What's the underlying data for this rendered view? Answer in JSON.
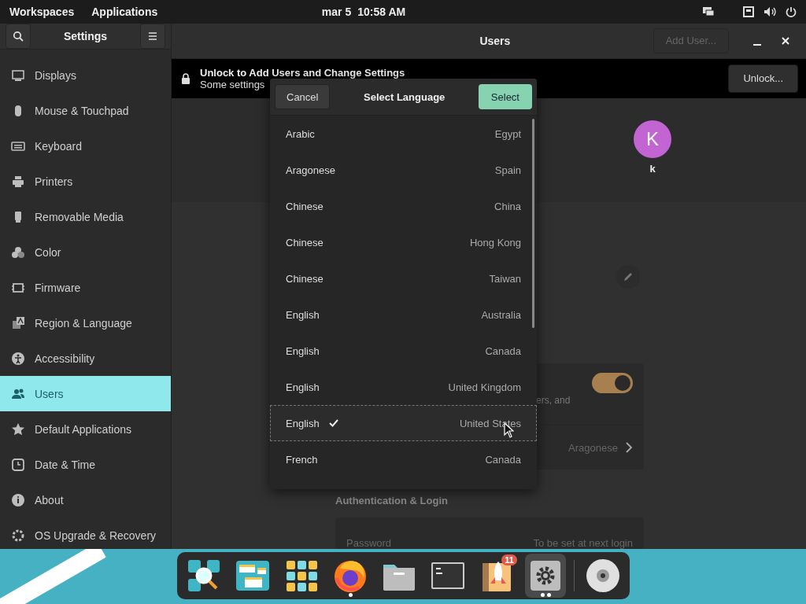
{
  "top_bar": {
    "workspaces": "Workspaces",
    "applications": "Applications",
    "date": "mar 5",
    "time": "10:58 AM"
  },
  "sidebar": {
    "title": "Settings",
    "items": [
      {
        "label": "Displays",
        "selected": false
      },
      {
        "label": "Mouse & Touchpad",
        "selected": false
      },
      {
        "label": "Keyboard",
        "selected": false
      },
      {
        "label": "Printers",
        "selected": false
      },
      {
        "label": "Removable Media",
        "selected": false
      },
      {
        "label": "Color",
        "selected": false
      },
      {
        "label": "Firmware",
        "selected": false
      },
      {
        "label": "Region & Language",
        "selected": false
      },
      {
        "label": "Accessibility",
        "selected": false
      },
      {
        "label": "Users",
        "selected": true
      },
      {
        "label": "Default Applications",
        "selected": false
      },
      {
        "label": "Date & Time",
        "selected": false
      },
      {
        "label": "About",
        "selected": false
      },
      {
        "label": "OS Upgrade & Recovery",
        "selected": false
      }
    ]
  },
  "header": {
    "title": "Users",
    "add_user": {
      "label": "Add User...",
      "disabled": true
    }
  },
  "infobar": {
    "title": "Unlock to Add Users and Change Settings",
    "subtitle": "Some settings",
    "button": "Unlock..."
  },
  "user": {
    "initial": "K",
    "name": "k"
  },
  "details": {
    "toggle": {
      "on": true
    },
    "toggle_text": "ers, and",
    "language": "Aragonese",
    "auth_heading": "Authentication & Login",
    "password": {
      "label": "Password",
      "value": "To be set at next login"
    }
  },
  "dialog": {
    "cancel": "Cancel",
    "title": "Select Language",
    "select": "Select",
    "languages": [
      {
        "language": "Arabic",
        "region": "Egypt",
        "selected": false
      },
      {
        "language": "Aragonese",
        "region": "Spain",
        "selected": false
      },
      {
        "language": "Chinese",
        "region": "China",
        "selected": false
      },
      {
        "language": "Chinese",
        "region": "Hong Kong",
        "selected": false
      },
      {
        "language": "Chinese",
        "region": "Taiwan",
        "selected": false
      },
      {
        "language": "English",
        "region": "Australia",
        "selected": false
      },
      {
        "language": "English",
        "region": "Canada",
        "selected": false
      },
      {
        "language": "English",
        "region": "United Kingdom",
        "selected": false
      },
      {
        "language": "English",
        "region": "United States",
        "selected": true
      },
      {
        "language": "French",
        "region": "Canada",
        "selected": false
      }
    ]
  },
  "dock": {
    "items": [
      {
        "kind": "search",
        "running": false,
        "active": false
      },
      {
        "kind": "workspaces",
        "running": false,
        "active": false
      },
      {
        "kind": "apps",
        "running": false,
        "active": false
      },
      {
        "kind": "browser",
        "running": true,
        "active": false
      },
      {
        "kind": "files",
        "running": false,
        "active": false
      },
      {
        "kind": "terminal",
        "running": false,
        "active": false
      },
      {
        "kind": "launcher",
        "running": false,
        "active": false,
        "badge": "11"
      },
      {
        "kind": "settings",
        "running": true,
        "multiple_windows": true,
        "active": true
      },
      {
        "kind": "disc",
        "running": false,
        "active": false
      }
    ]
  }
}
